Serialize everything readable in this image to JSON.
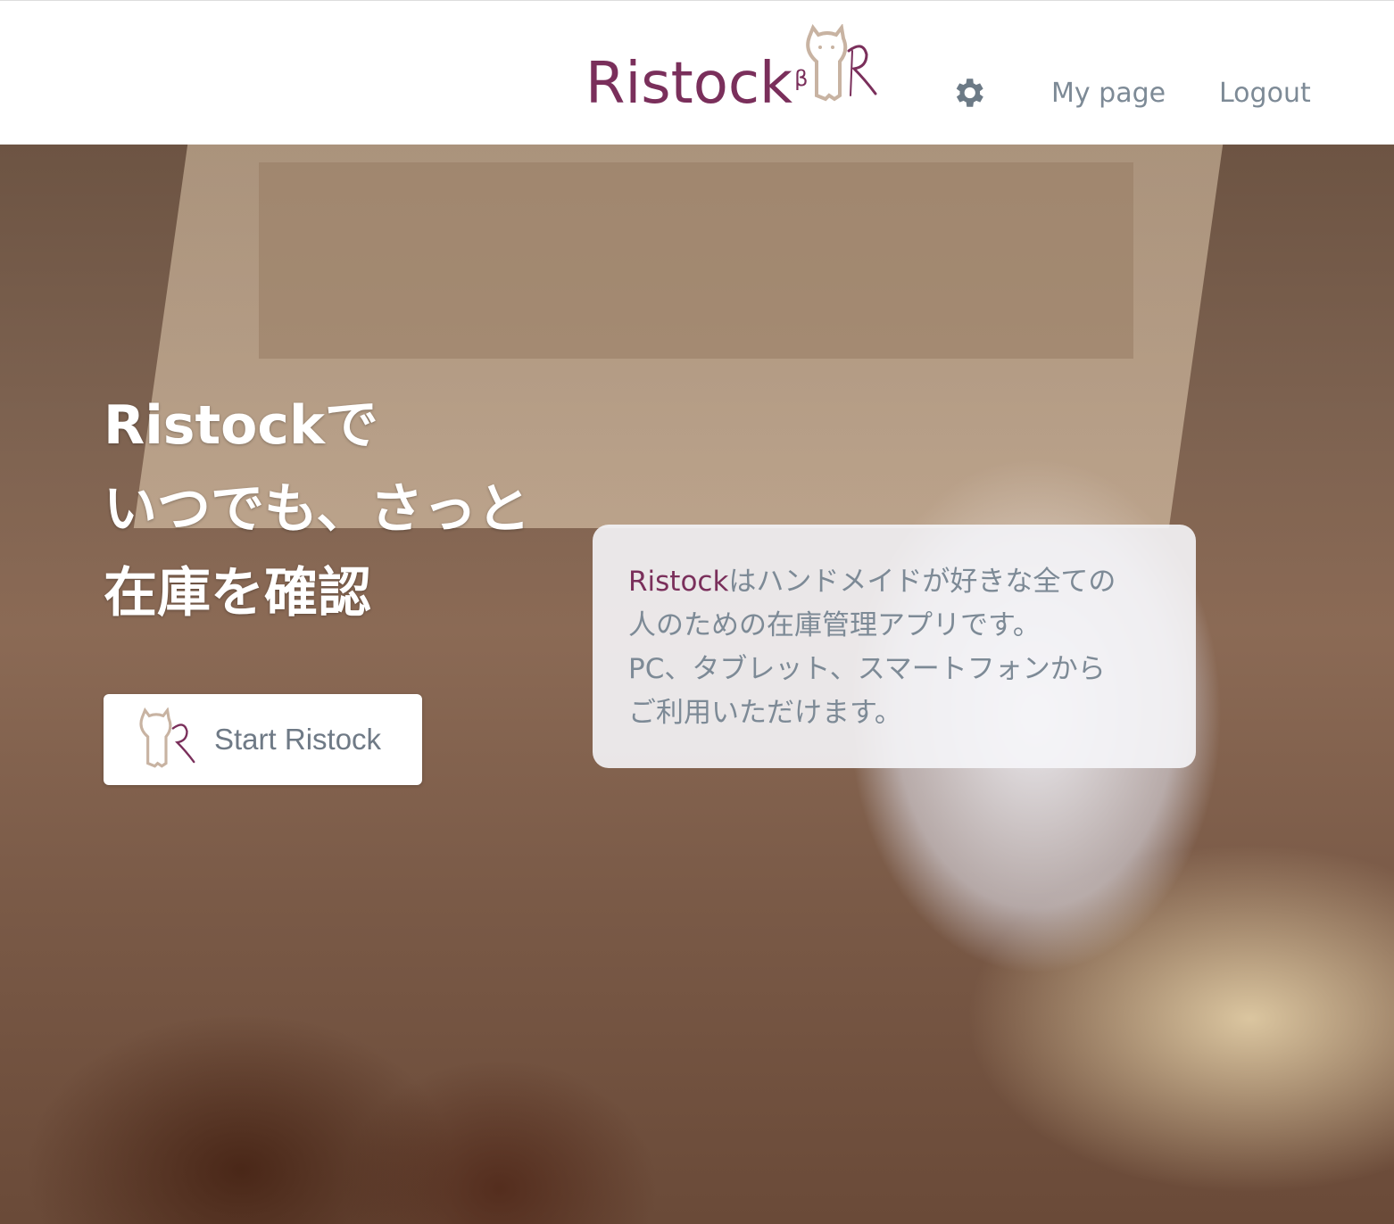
{
  "header": {
    "logo_text": "Ristock",
    "logo_badge": "β",
    "nav": {
      "settings_icon": "gear-icon",
      "my_page": "My page",
      "logout": "Logout"
    }
  },
  "hero": {
    "headline": [
      "Ristockで",
      "いつでも、さっと",
      "在庫を確認"
    ],
    "start_button": "Start Ristock",
    "description": {
      "brand": "Ristock",
      "line1_rest": "はハンドメイドが好きな全ての",
      "line2": "人のための在庫管理アプリです。",
      "line3": "PC、タブレット、スマートフォンから",
      "line4": "ご利用いただけます。"
    }
  },
  "colors": {
    "brand": "#7a2f5b",
    "nav_text": "#7d8a96"
  }
}
